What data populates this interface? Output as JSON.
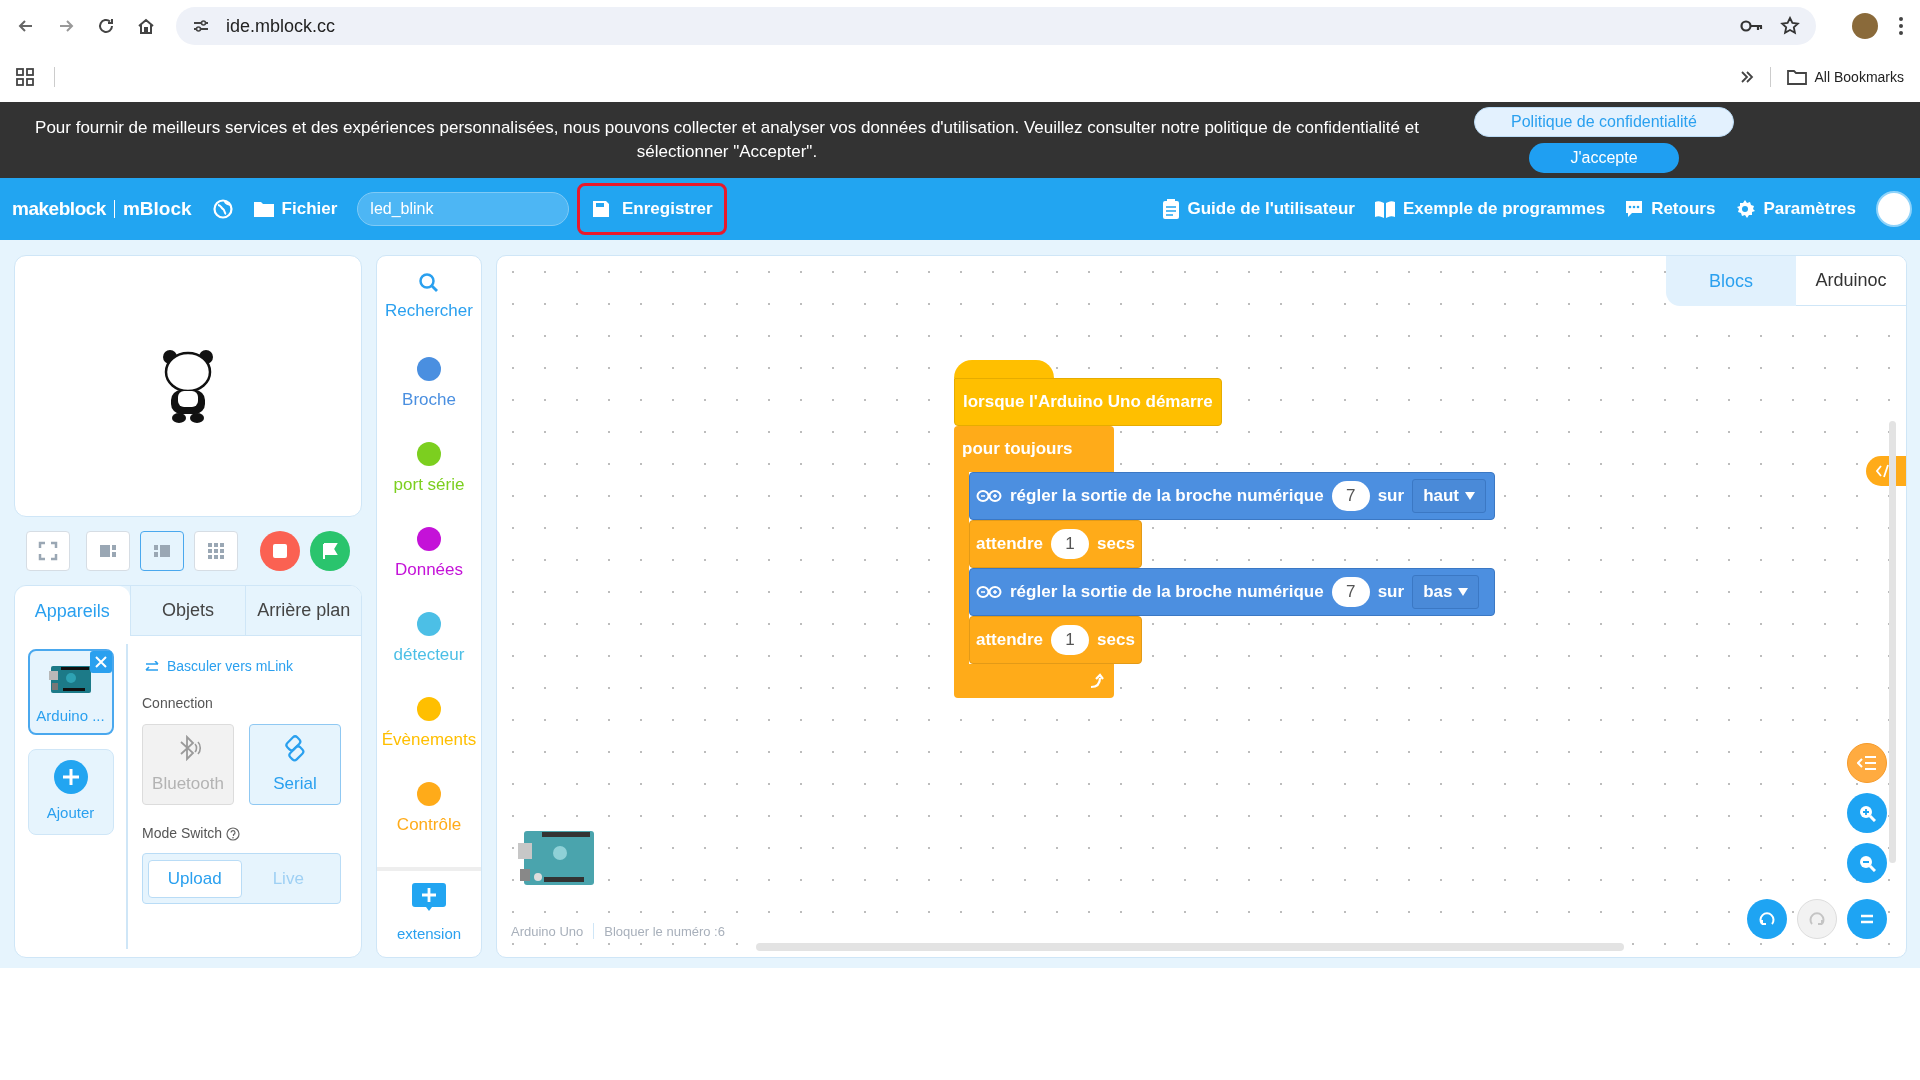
{
  "browser": {
    "url": "ide.mblock.cc",
    "bookmarks_label": "All Bookmarks"
  },
  "cookie_banner": {
    "message": "Pour fournir de meilleurs services et des expériences personnalisées, nous pouvons collecter et analyser vos données d'utilisation. Veuillez consulter notre politique de confidentialité et sélectionner \"Accepter\".",
    "buttons": [
      {
        "label": "Politique de confidentialité",
        "kind": "secondary"
      },
      {
        "label": "J'accepte",
        "kind": "primary"
      }
    ]
  },
  "header": {
    "brand": "makeblock",
    "product": "mBlock",
    "file_menu": "Fichier",
    "project_name": "led_blink",
    "save": {
      "label": "Enregistrer",
      "highlighted": true
    },
    "links": [
      {
        "label": "Guide de l'utilisateur",
        "kind": "guide"
      },
      {
        "label": "Exemple de programmes",
        "kind": "examples"
      },
      {
        "label": "Retours",
        "kind": "feedback"
      },
      {
        "label": "Paramètres",
        "kind": "settings"
      }
    ]
  },
  "stage_layouts": [
    {
      "kind": "fullscreen",
      "selected": false
    },
    {
      "kind": "large",
      "selected": false
    },
    {
      "kind": "small",
      "selected": true
    },
    {
      "kind": "grid",
      "selected": false
    }
  ],
  "sprite_tabs": [
    {
      "label": "Appareils",
      "selected": true
    },
    {
      "label": "Objets",
      "selected": false
    },
    {
      "label": "Arrière plan",
      "selected": false
    }
  ],
  "devices": [
    {
      "label": "Arduino ...",
      "selected": true
    }
  ],
  "add_device": "Ajouter",
  "switch_link": "Basculer vers mLink",
  "connection": {
    "label": "Connection",
    "options": [
      {
        "label": "Bluetooth",
        "kind": "bluetooth",
        "selected": false,
        "disabled": true
      },
      {
        "label": "Serial",
        "kind": "serial",
        "selected": true,
        "disabled": false
      }
    ]
  },
  "mode_switch": {
    "label": "Mode Switch",
    "options": [
      {
        "label": "Upload",
        "selected": true
      },
      {
        "label": "Live",
        "selected": false
      }
    ]
  },
  "search_label": "Rechercher",
  "categories": [
    {
      "label": "Broche",
      "color": "#4a8fe0"
    },
    {
      "label": "port série",
      "color": "#7ccf1f"
    },
    {
      "label": "Données",
      "color": "#c412d8"
    },
    {
      "label": "détecteur",
      "color": "#4cbfe6"
    },
    {
      "label": "Évènements",
      "color": "#ffbf00"
    },
    {
      "label": "Contrôle",
      "color": "#ffab19"
    }
  ],
  "extension_label": "extension",
  "editor_tabs": [
    {
      "label": "Blocs",
      "selected": true
    },
    {
      "label": "Arduinoc",
      "selected": false
    }
  ],
  "script": [
    {
      "kind": "hat",
      "text": "lorsque l'Arduino Uno démarre"
    },
    {
      "kind": "forever",
      "text": "pour toujours",
      "children": [
        {
          "kind": "pin",
          "text": "régler la sortie de la broche numérique",
          "pin": "7",
          "joiner": "sur",
          "value": "haut"
        },
        {
          "kind": "wait",
          "text": "attendre",
          "value": "1",
          "unit": "secs"
        },
        {
          "kind": "pin",
          "text": "régler la sortie de la broche numérique",
          "pin": "7",
          "joiner": "sur",
          "value": "bas"
        },
        {
          "kind": "wait",
          "text": "attendre",
          "value": "1",
          "unit": "secs"
        }
      ]
    }
  ],
  "footer": {
    "device": "Arduino Uno",
    "block_count": "Bloquer le numéro :6"
  }
}
